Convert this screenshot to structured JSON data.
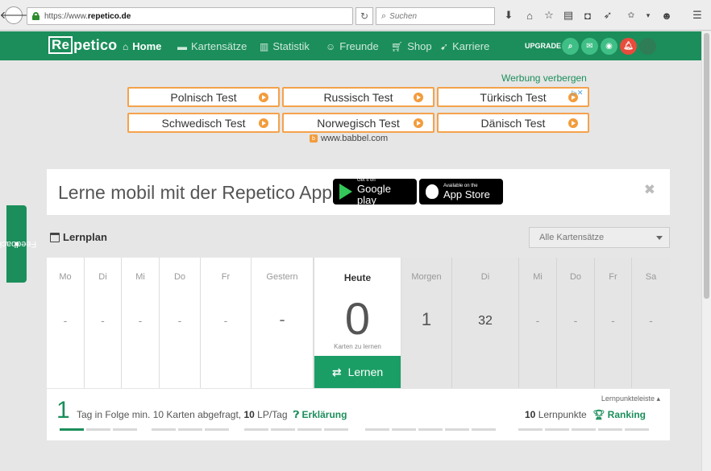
{
  "browser": {
    "url_prefix": "https://www.",
    "url_domain": "repetico.de",
    "search_placeholder": "Suchen",
    "reload_icon": "reload-icon",
    "back_icon": "back-arrow-icon"
  },
  "nav": {
    "logo": "Repetico",
    "items": [
      {
        "label": "Home",
        "icon": "home-icon",
        "active": true
      },
      {
        "label": "Kartensätze",
        "icon": "cards-icon"
      },
      {
        "label": "Statistik",
        "icon": "chart-icon"
      },
      {
        "label": "Freunde",
        "icon": "friends-icon"
      },
      {
        "label": "Shop",
        "icon": "cart-icon"
      },
      {
        "label": "Karriere",
        "icon": "rocket-icon"
      }
    ],
    "upgrade": "UPGRADE",
    "colors": {
      "brand": "#1b8e5b",
      "notification": "#e74c3c"
    }
  },
  "ads": {
    "hide_label": "Werbung verbergen",
    "boxes": [
      "Polnisch Test",
      "Russisch Test",
      "Türkisch Test",
      "Schwedisch Test",
      "Norwegisch Test",
      "Dänisch Test"
    ],
    "source": "www.babbel.com",
    "accent": "#f4a24b"
  },
  "feedback": {
    "label": "Feedback"
  },
  "banner": {
    "text": "Lerne mobil mit der Repetico App!",
    "google_small": "Get it on",
    "google_large": "Google play",
    "apple_small": "Available on the",
    "apple_large": "App Store"
  },
  "lernplan": {
    "title": "Lernplan",
    "filter": "Alle Kartensätze",
    "days": [
      {
        "name": "Mo",
        "value": "-"
      },
      {
        "name": "Di",
        "value": "-"
      },
      {
        "name": "Mi",
        "value": "-"
      },
      {
        "name": "Do",
        "value": "-"
      },
      {
        "name": "Fr",
        "value": "-"
      },
      {
        "name": "Gestern",
        "value": "-"
      }
    ],
    "today": {
      "name": "Heute",
      "value": "0",
      "sub": "Karten zu lernen",
      "button": "Lernen"
    },
    "future": [
      {
        "name": "Morgen",
        "value": "1"
      },
      {
        "name": "Di",
        "value": "32"
      },
      {
        "name": "Mi",
        "value": "-"
      },
      {
        "name": "Do",
        "value": "-"
      },
      {
        "name": "Fr",
        "value": "-"
      },
      {
        "name": "Sa",
        "value": "-"
      }
    ]
  },
  "streak": {
    "count": "1",
    "text": "Tag in Folge min. 10 Karten abgefragt,",
    "lp_value": "10",
    "lp_text": "LP/Tag",
    "explain": "Erklärung",
    "leiste": "Lernpunkteleiste ▴",
    "points_value": "10",
    "points_text": "Lernpunkte",
    "ranking": "Ranking"
  }
}
